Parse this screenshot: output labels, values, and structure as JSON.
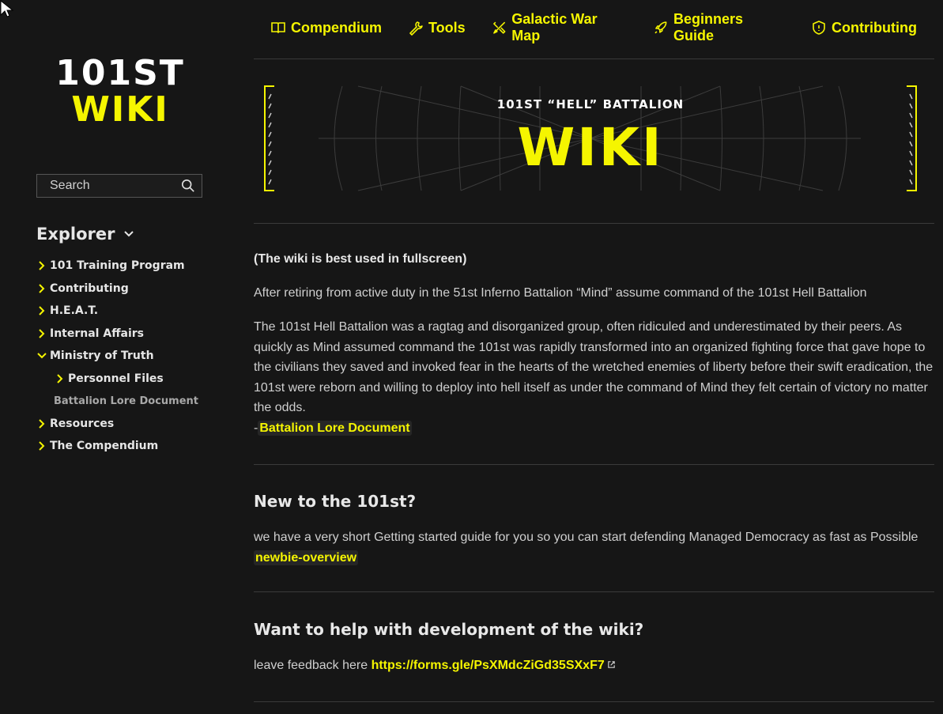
{
  "sidebar": {
    "logo_line1": "101ST",
    "logo_line2": "WIKI",
    "search_placeholder": "Search",
    "explorer_title": "Explorer",
    "items": [
      {
        "label": "101 Training Program",
        "expanded": false
      },
      {
        "label": "Contributing",
        "expanded": false
      },
      {
        "label": "H.E.A.T.",
        "expanded": false
      },
      {
        "label": "Internal Affairs",
        "expanded": false
      },
      {
        "label": "Ministry of Truth",
        "expanded": true
      },
      {
        "label": "Resources",
        "expanded": false
      },
      {
        "label": "The Compendium",
        "expanded": false
      }
    ],
    "ministry_children": {
      "personnel_files": "Personnel Files",
      "lore_document": "Battalion Lore Document"
    }
  },
  "topnav": [
    {
      "label": "Compendium",
      "icon": "book-icon"
    },
    {
      "label": "Tools",
      "icon": "wrench-icon"
    },
    {
      "label": "Galactic War Map",
      "icon": "map-tools-icon"
    },
    {
      "label": "Beginners Guide",
      "icon": "rocket-icon"
    },
    {
      "label": "Contributing",
      "icon": "shield-icon"
    }
  ],
  "banner": {
    "subtitle": "101ST “HELL” BATTALION",
    "title": "WIKI"
  },
  "content": {
    "fullscreen_note": "(The wiki is best used in fullscreen)",
    "intro": "After retiring from active duty in the 51st Inferno Battalion “Mind” assume command of the 101st Hell Battalion",
    "history": "The 101st Hell Battalion was a ragtag and disorganized group, often ridiculed and underestimated by their peers. As quickly as Mind assumed command the 101st was rapidly transformed into an organized fighting force that gave hope to the civilians they saved and invoked fear in the hearts of the wretched enemies of liberty before their swift eradica­tion, the 101st were reborn and willing to deploy into hell itself as under the command of Mind they felt certain of vic­tory no matter the odds.",
    "dash": "-",
    "lore_link": "Battalion Lore Document",
    "new_heading": "New to the 101st?",
    "new_text": "we have a very short Getting started guide for you so you can start defending Managed Democracy as fast as Possible",
    "new_link": "newbie-overview",
    "help_heading": "Want to help with development of the wiki?",
    "help_text": "leave feedback here",
    "help_link": "https://forms.gle/PsXMdcZiGd35SXxF7"
  },
  "colors": {
    "accent": "#f5f500",
    "background": "#161616",
    "text": "#cfcfcf"
  }
}
